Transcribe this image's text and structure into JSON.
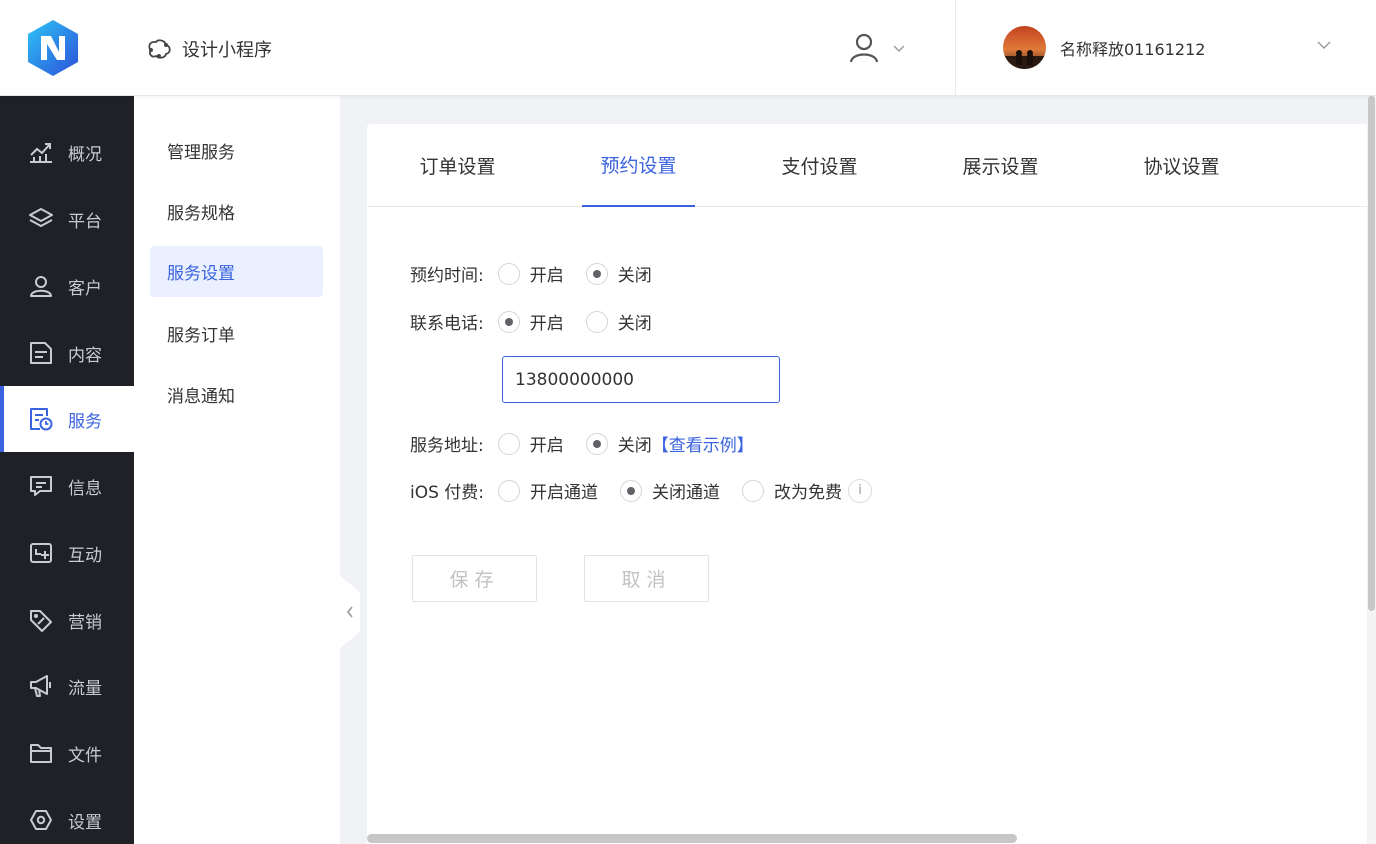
{
  "header": {
    "app_title": "设计小程序",
    "account_name": "名称释放01161212"
  },
  "sidebar": {
    "items": [
      {
        "label": "概况",
        "icon": "chart-line-icon",
        "active": false
      },
      {
        "label": "平台",
        "icon": "layers-icon",
        "active": false
      },
      {
        "label": "客户",
        "icon": "user-icon",
        "active": false
      },
      {
        "label": "内容",
        "icon": "document-icon",
        "active": false
      },
      {
        "label": "服务",
        "icon": "service-clock-icon",
        "active": true
      },
      {
        "label": "信息",
        "icon": "message-icon",
        "active": false
      },
      {
        "label": "互动",
        "icon": "interaction-icon",
        "active": false
      },
      {
        "label": "营销",
        "icon": "tag-icon",
        "active": false
      },
      {
        "label": "流量",
        "icon": "megaphone-icon",
        "active": false
      },
      {
        "label": "文件",
        "icon": "folder-icon",
        "active": false
      },
      {
        "label": "设置",
        "icon": "gear-icon",
        "active": false
      }
    ]
  },
  "subnav": {
    "items": [
      {
        "label": "管理服务",
        "active": false
      },
      {
        "label": "服务规格",
        "active": false
      },
      {
        "label": "服务设置",
        "active": true
      },
      {
        "label": "服务订单",
        "active": false
      },
      {
        "label": "消息通知",
        "active": false
      }
    ]
  },
  "tabs": [
    {
      "label": "订单设置",
      "active": false
    },
    {
      "label": "预约设置",
      "active": true
    },
    {
      "label": "支付设置",
      "active": false
    },
    {
      "label": "展示设置",
      "active": false
    },
    {
      "label": "协议设置",
      "active": false
    }
  ],
  "form": {
    "booking_time": {
      "label": "预约时间:",
      "options": [
        "开启",
        "关闭"
      ],
      "selected": "关闭"
    },
    "contact_phone": {
      "label": "联系电话:",
      "options": [
        "开启",
        "关闭"
      ],
      "selected": "开启",
      "value": "13800000000"
    },
    "service_address": {
      "label": "服务地址:",
      "options": [
        "开启",
        "关闭"
      ],
      "selected": "关闭",
      "example_link": "【查看示例】"
    },
    "ios_payment": {
      "label": "iOS 付费:",
      "options": [
        "开启通道",
        "关闭通道",
        "改为免费"
      ],
      "selected": "关闭通道"
    }
  },
  "buttons": {
    "save": "保存",
    "cancel": "取消"
  },
  "colors": {
    "accent": "#3b63e0",
    "sidebar_bg": "#1f2127"
  }
}
